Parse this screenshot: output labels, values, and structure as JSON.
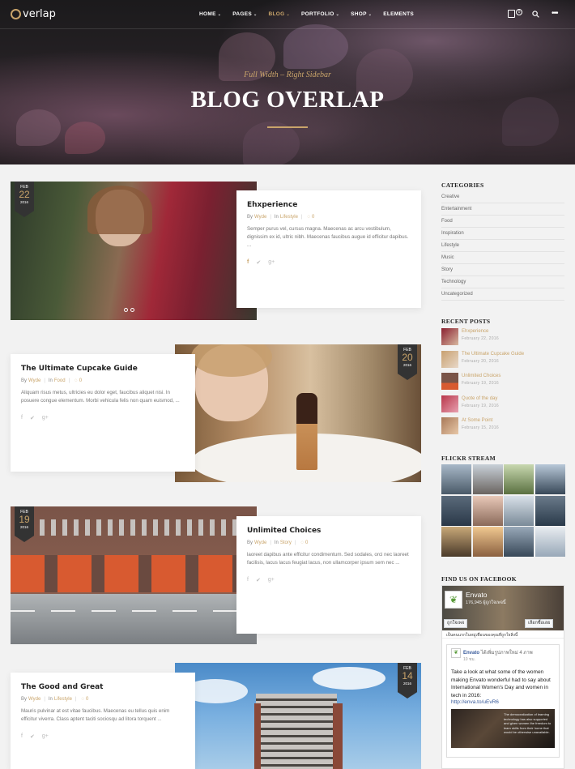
{
  "nav": {
    "logo": "verlap",
    "items": [
      {
        "label": "HOME",
        "dropdown": true,
        "active": false
      },
      {
        "label": "PAGES",
        "dropdown": true,
        "active": false
      },
      {
        "label": "BLOG",
        "dropdown": true,
        "active": true
      },
      {
        "label": "PORTFOLIO",
        "dropdown": true,
        "active": false
      },
      {
        "label": "SHOP",
        "dropdown": true,
        "active": false
      },
      {
        "label": "ELEMENTS",
        "dropdown": false,
        "active": false
      }
    ],
    "cart_count": "0"
  },
  "hero": {
    "subtitle": "Full Width – Right Sidebar",
    "title": "BLOG OVERLAP"
  },
  "posts": [
    {
      "title": "Ehxperience",
      "author": "Wyde",
      "category": "Lifestyle",
      "comments": "0",
      "excerpt": "Semper purus vel, cursus magna. Maecenas ac arcu vestibulum, dignissim ex id, ultric nibh. Maecenas faucibus augue id efficitur dapibus. ...",
      "date": {
        "month": "FEB",
        "day": "22",
        "year": "2016"
      }
    },
    {
      "title": "The Ultimate Cupcake Guide",
      "author": "Wyde",
      "category": "Food",
      "comments": "0",
      "excerpt": "Aliquam risus metus, ultricies eu dolor eget, faucibus aliquet nisi. In posuere congue elementum. Morbi vehicula felis non quam euismod, ...",
      "date": {
        "month": "FEB",
        "day": "20",
        "year": "2016"
      }
    },
    {
      "title": "Unlimited Choices",
      "author": "Wyde",
      "category": "Story",
      "comments": "0",
      "excerpt": "laoreet dapibus ante efficitur condimentum. Sed sodales, orci nec laoreet facilisis, lacus lacus feugiat lacus, non ullamcorper ipsum sem nec ...",
      "date": {
        "month": "FEB",
        "day": "19",
        "year": "2016"
      }
    },
    {
      "title": "The Good and Great",
      "author": "Wyde",
      "category": "Lifestyle",
      "comments": "0",
      "excerpt": "Mauris pulvinar at est vitae faucibus. Maecenas eu tellus quis enim efficitur viverra. Class aptent taciti sociosqu ad litora torquent ...",
      "date": {
        "month": "FEB",
        "day": "14",
        "year": "2016"
      }
    }
  ],
  "meta_labels": {
    "by": "By",
    "in": "In"
  },
  "sidebar": {
    "categories_heading": "CATEGORIES",
    "categories": [
      "Creative",
      "Entertainment",
      "Food",
      "Inspiration",
      "Lifestyle",
      "Music",
      "Story",
      "Technology",
      "Uncategorized"
    ],
    "recent_heading": "RECENT POSTS",
    "recent": [
      {
        "title": "Ehxperience",
        "date": "February 22, 2016"
      },
      {
        "title": "The Ultimate Cupcake Guide",
        "date": "February 20, 2016"
      },
      {
        "title": "Unlimited Choices",
        "date": "February 19, 2016"
      },
      {
        "title": "Quote of the day",
        "date": "February 19, 2016"
      },
      {
        "title": "At Some Point",
        "date": "February 15, 2016"
      }
    ],
    "flickr_heading": "FLICKR STREAM",
    "facebook_heading": "FIND US ON FACEBOOK",
    "facebook": {
      "name": "Envato",
      "likes": "176,945 ผู้ถูกใจเพจนี้",
      "like_btn": "ถูกใจเพจ",
      "share_btn": "เลือกซื้อเลย",
      "friends_text": "เป็นคนแรกในหมู่เพื่อนของคุณที่ถูกใจสิ่งนี้",
      "post_author": "Envato",
      "post_action": "ได้เพิ่มรูปภาพใหม่ 4 ภาพ",
      "post_time": "10 ชม.",
      "post_text": "Take a look at what some of the women making Envato wonderful had to say about International Women's Day and women in tech in 2016:",
      "post_link": "http://enva.to/uEvR6",
      "image_text": "The democratization of learning technology has also supported and given women the freedom to learn skills from their home that would be otherwise unavailable."
    }
  }
}
